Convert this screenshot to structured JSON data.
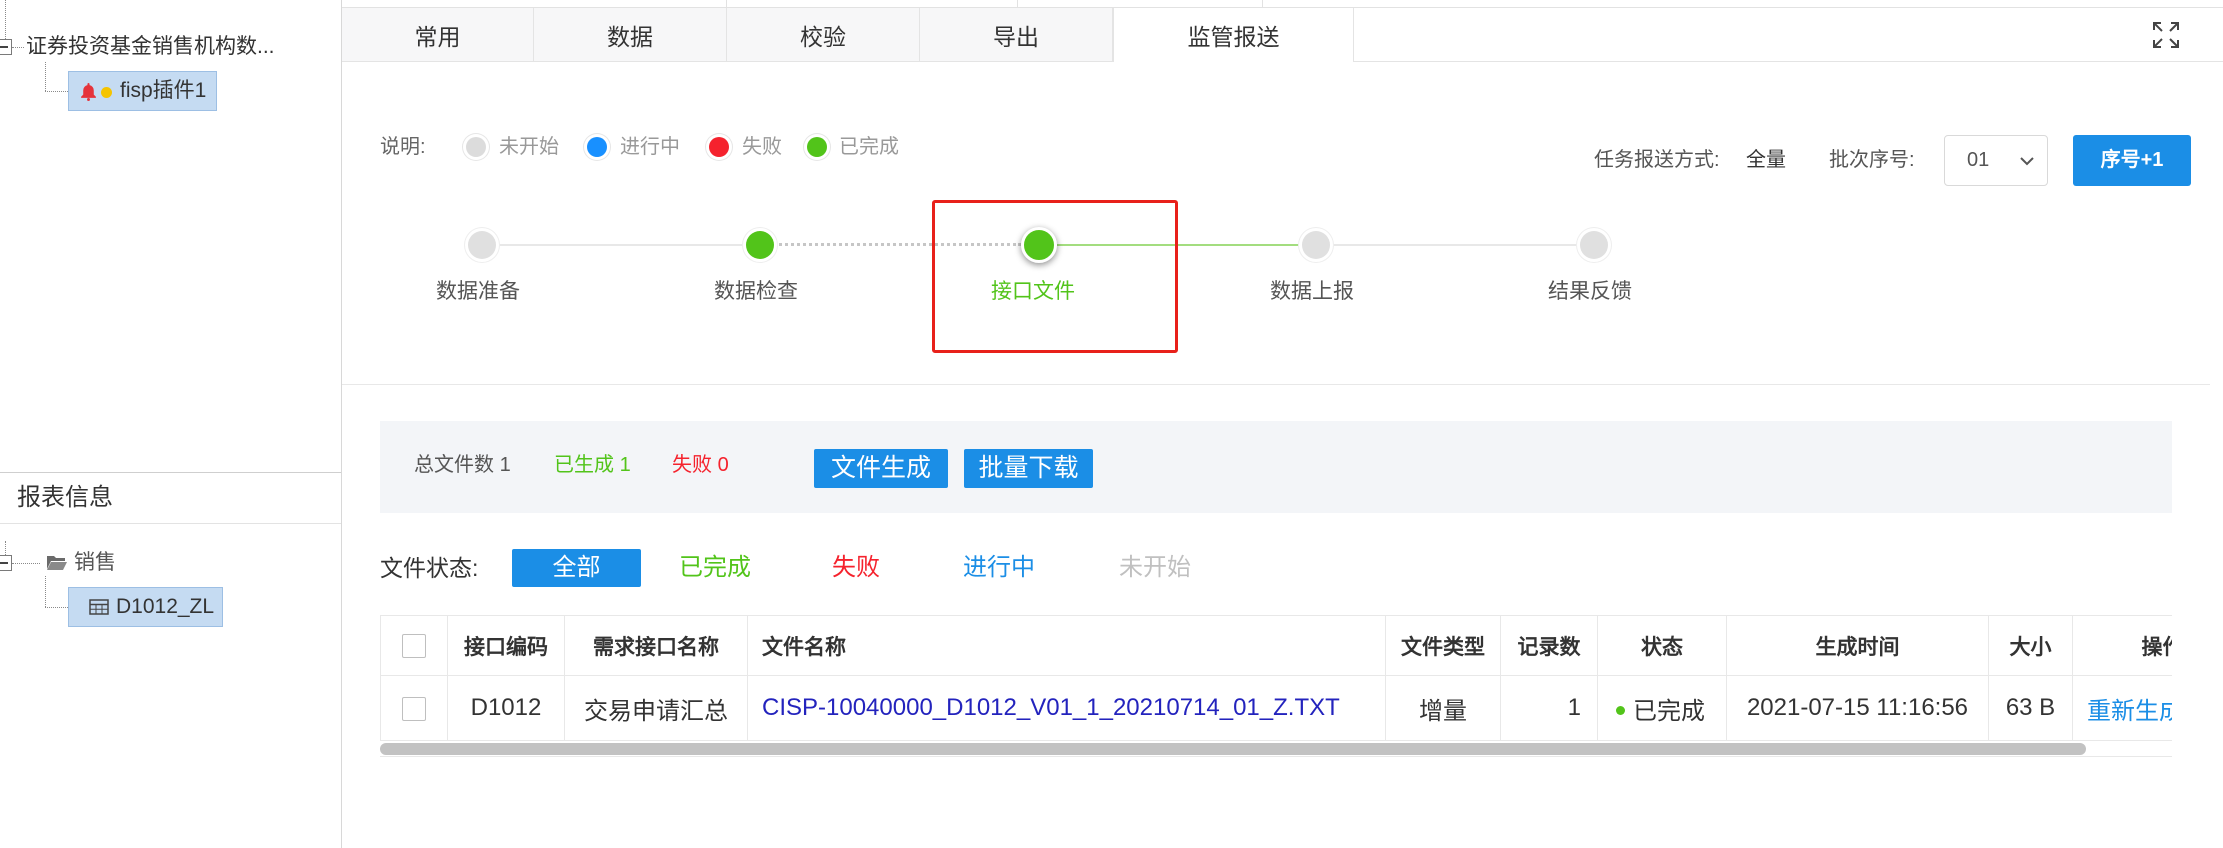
{
  "left_panel": {
    "top_tree": {
      "root": {
        "label": "证券投资基金销售机构数...",
        "expanded": true
      },
      "child": {
        "label": "fisp插件1",
        "icons": [
          "bell-icon",
          "status-dot-icon"
        ],
        "selected": true
      }
    },
    "report_info": {
      "title": "报表信息",
      "folder": {
        "label": "销售",
        "icon": "folder-icon",
        "expanded": true
      },
      "table_node": {
        "label": "D1012_ZL",
        "icon": "table-icon",
        "selected": true
      }
    }
  },
  "tabs": [
    {
      "label": "常用",
      "active": false
    },
    {
      "label": "数据",
      "active": false
    },
    {
      "label": "校验",
      "active": false
    },
    {
      "label": "导出",
      "active": false
    },
    {
      "label": "监管报送",
      "active": true
    }
  ],
  "toolbar": {
    "fullscreen_icon": "fullscreen-icon"
  },
  "legend": {
    "label": "说明:",
    "items": [
      {
        "label": "未开始",
        "color": "#dcdcdc"
      },
      {
        "label": "进行中",
        "color": "#1890ff"
      },
      {
        "label": "失败",
        "color": "#f5222d"
      },
      {
        "label": "已完成",
        "color": "#52c41a"
      }
    ]
  },
  "task": {
    "mode_label": "任务报送方式:",
    "mode_value": "全量",
    "batch_label": "批次序号:",
    "batch_value": "01",
    "increment_button": "序号+1"
  },
  "steps": [
    {
      "label": "数据准备",
      "color": "#e0e0e0",
      "current": false
    },
    {
      "label": "数据检查",
      "color": "#52c41a",
      "current": false
    },
    {
      "label": "接口文件",
      "color": "#52c41a",
      "current": true
    },
    {
      "label": "数据上报",
      "color": "#e0e0e0",
      "current": false
    },
    {
      "label": "结果反馈",
      "color": "#e0e0e0",
      "current": false
    }
  ],
  "summary": {
    "total_label": "总文件数",
    "total": 1,
    "generated_label": "已生成",
    "generated": 1,
    "failed_label": "失败",
    "failed": 0,
    "generate_button": "文件生成",
    "download_button": "批量下载"
  },
  "filter": {
    "label": "文件状态:",
    "options": [
      "全部",
      "已完成",
      "失败",
      "进行中",
      "未开始"
    ],
    "selected_index": 0
  },
  "table": {
    "columns": [
      "接口编码",
      "需求接口名称",
      "文件名称",
      "文件类型",
      "记录数",
      "状态",
      "生成时间",
      "大小",
      "操作"
    ],
    "rows": [
      {
        "code": "D1012",
        "interface_name": "交易申请汇总",
        "file_name": "CISP-10040000_D1012_V01_1_20210714_01_Z.TXT",
        "file_type": "增量",
        "record_count": 1,
        "status": "已完成",
        "status_color": "#52c41a",
        "generated_at": "2021-07-15 11:16:56",
        "size": "63 B",
        "action": "重新生成"
      }
    ]
  },
  "colors": {
    "primary": "#1b8ee6",
    "success": "#52c41a",
    "danger": "#f5222d",
    "inactive": "#c0c0c0",
    "link": "#2323bd",
    "highlight_box": "#e8201a",
    "step_line_done": "#a3dd7f",
    "step_line_idle": "#e8e8e8"
  }
}
